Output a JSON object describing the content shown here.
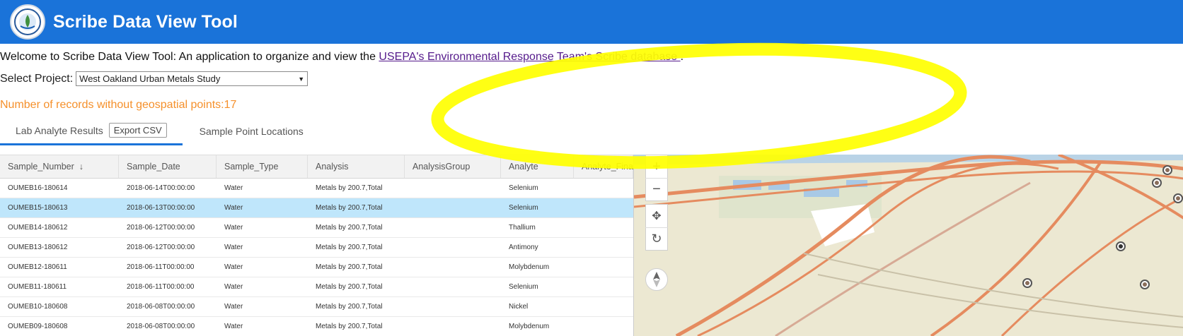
{
  "app": {
    "title": "Scribe Data View Tool",
    "logo": "epa-seal-logo"
  },
  "welcome": {
    "prefix": "Welcome to Scribe Data View Tool: An application to organize and view the ",
    "link_text": "USEPA's Environmental Response Team's Scribe database ",
    "suffix": "."
  },
  "project": {
    "label": "Select Project:",
    "selected": "West Oakland Urban Metals Study"
  },
  "records_notice": "Number of records without geospatial points:17",
  "tabs": [
    {
      "label": "Lab Analyte Results",
      "active": true
    },
    {
      "label": "Sample Point Locations",
      "active": false
    }
  ],
  "export_label": "Export CSV",
  "grid": {
    "columns": [
      "Sample_Number",
      "Sample_Date",
      "Sample_Type",
      "Analysis",
      "AnalysisGroup",
      "Analyte",
      "Analyte_Final"
    ],
    "sort_indicator": "↓",
    "rows": [
      [
        "OUMEB16-180614",
        "2018-06-14T00:00:00",
        "Water",
        "Metals by 200.7,Total",
        "",
        "Selenium"
      ],
      [
        "OUMEB15-180613",
        "2018-06-13T00:00:00",
        "Water",
        "Metals by 200.7,Total",
        "",
        "Selenium"
      ],
      [
        "OUMEB14-180612",
        "2018-06-12T00:00:00",
        "Water",
        "Metals by 200.7,Total",
        "",
        "Thallium"
      ],
      [
        "OUMEB13-180612",
        "2018-06-12T00:00:00",
        "Water",
        "Metals by 200.7,Total",
        "",
        "Antimony"
      ],
      [
        "OUMEB12-180611",
        "2018-06-11T00:00:00",
        "Water",
        "Metals by 200.7,Total",
        "",
        "Molybdenum"
      ],
      [
        "OUMEB11-180611",
        "2018-06-11T00:00:00",
        "Water",
        "Metals by 200.7,Total",
        "",
        "Selenium"
      ],
      [
        "OUMEB10-180608",
        "2018-06-08T00:00:00",
        "Water",
        "Metals by 200.7,Total",
        "",
        "Nickel"
      ],
      [
        "OUMEB09-180608",
        "2018-06-08T00:00:00",
        "Water",
        "Metals by 200.7,Total",
        "",
        "Molybdenum"
      ]
    ],
    "selected_row_index": 1
  },
  "map": {
    "controls": [
      "zoom-in-icon",
      "zoom-out-icon",
      "pan-icon",
      "rotate-icon",
      "compass-icon"
    ]
  },
  "colors": {
    "header": "#1a73d9",
    "accent_orange": "#f5902b",
    "selected_row": "#bfe6fb",
    "highlight": "#ffff00"
  }
}
